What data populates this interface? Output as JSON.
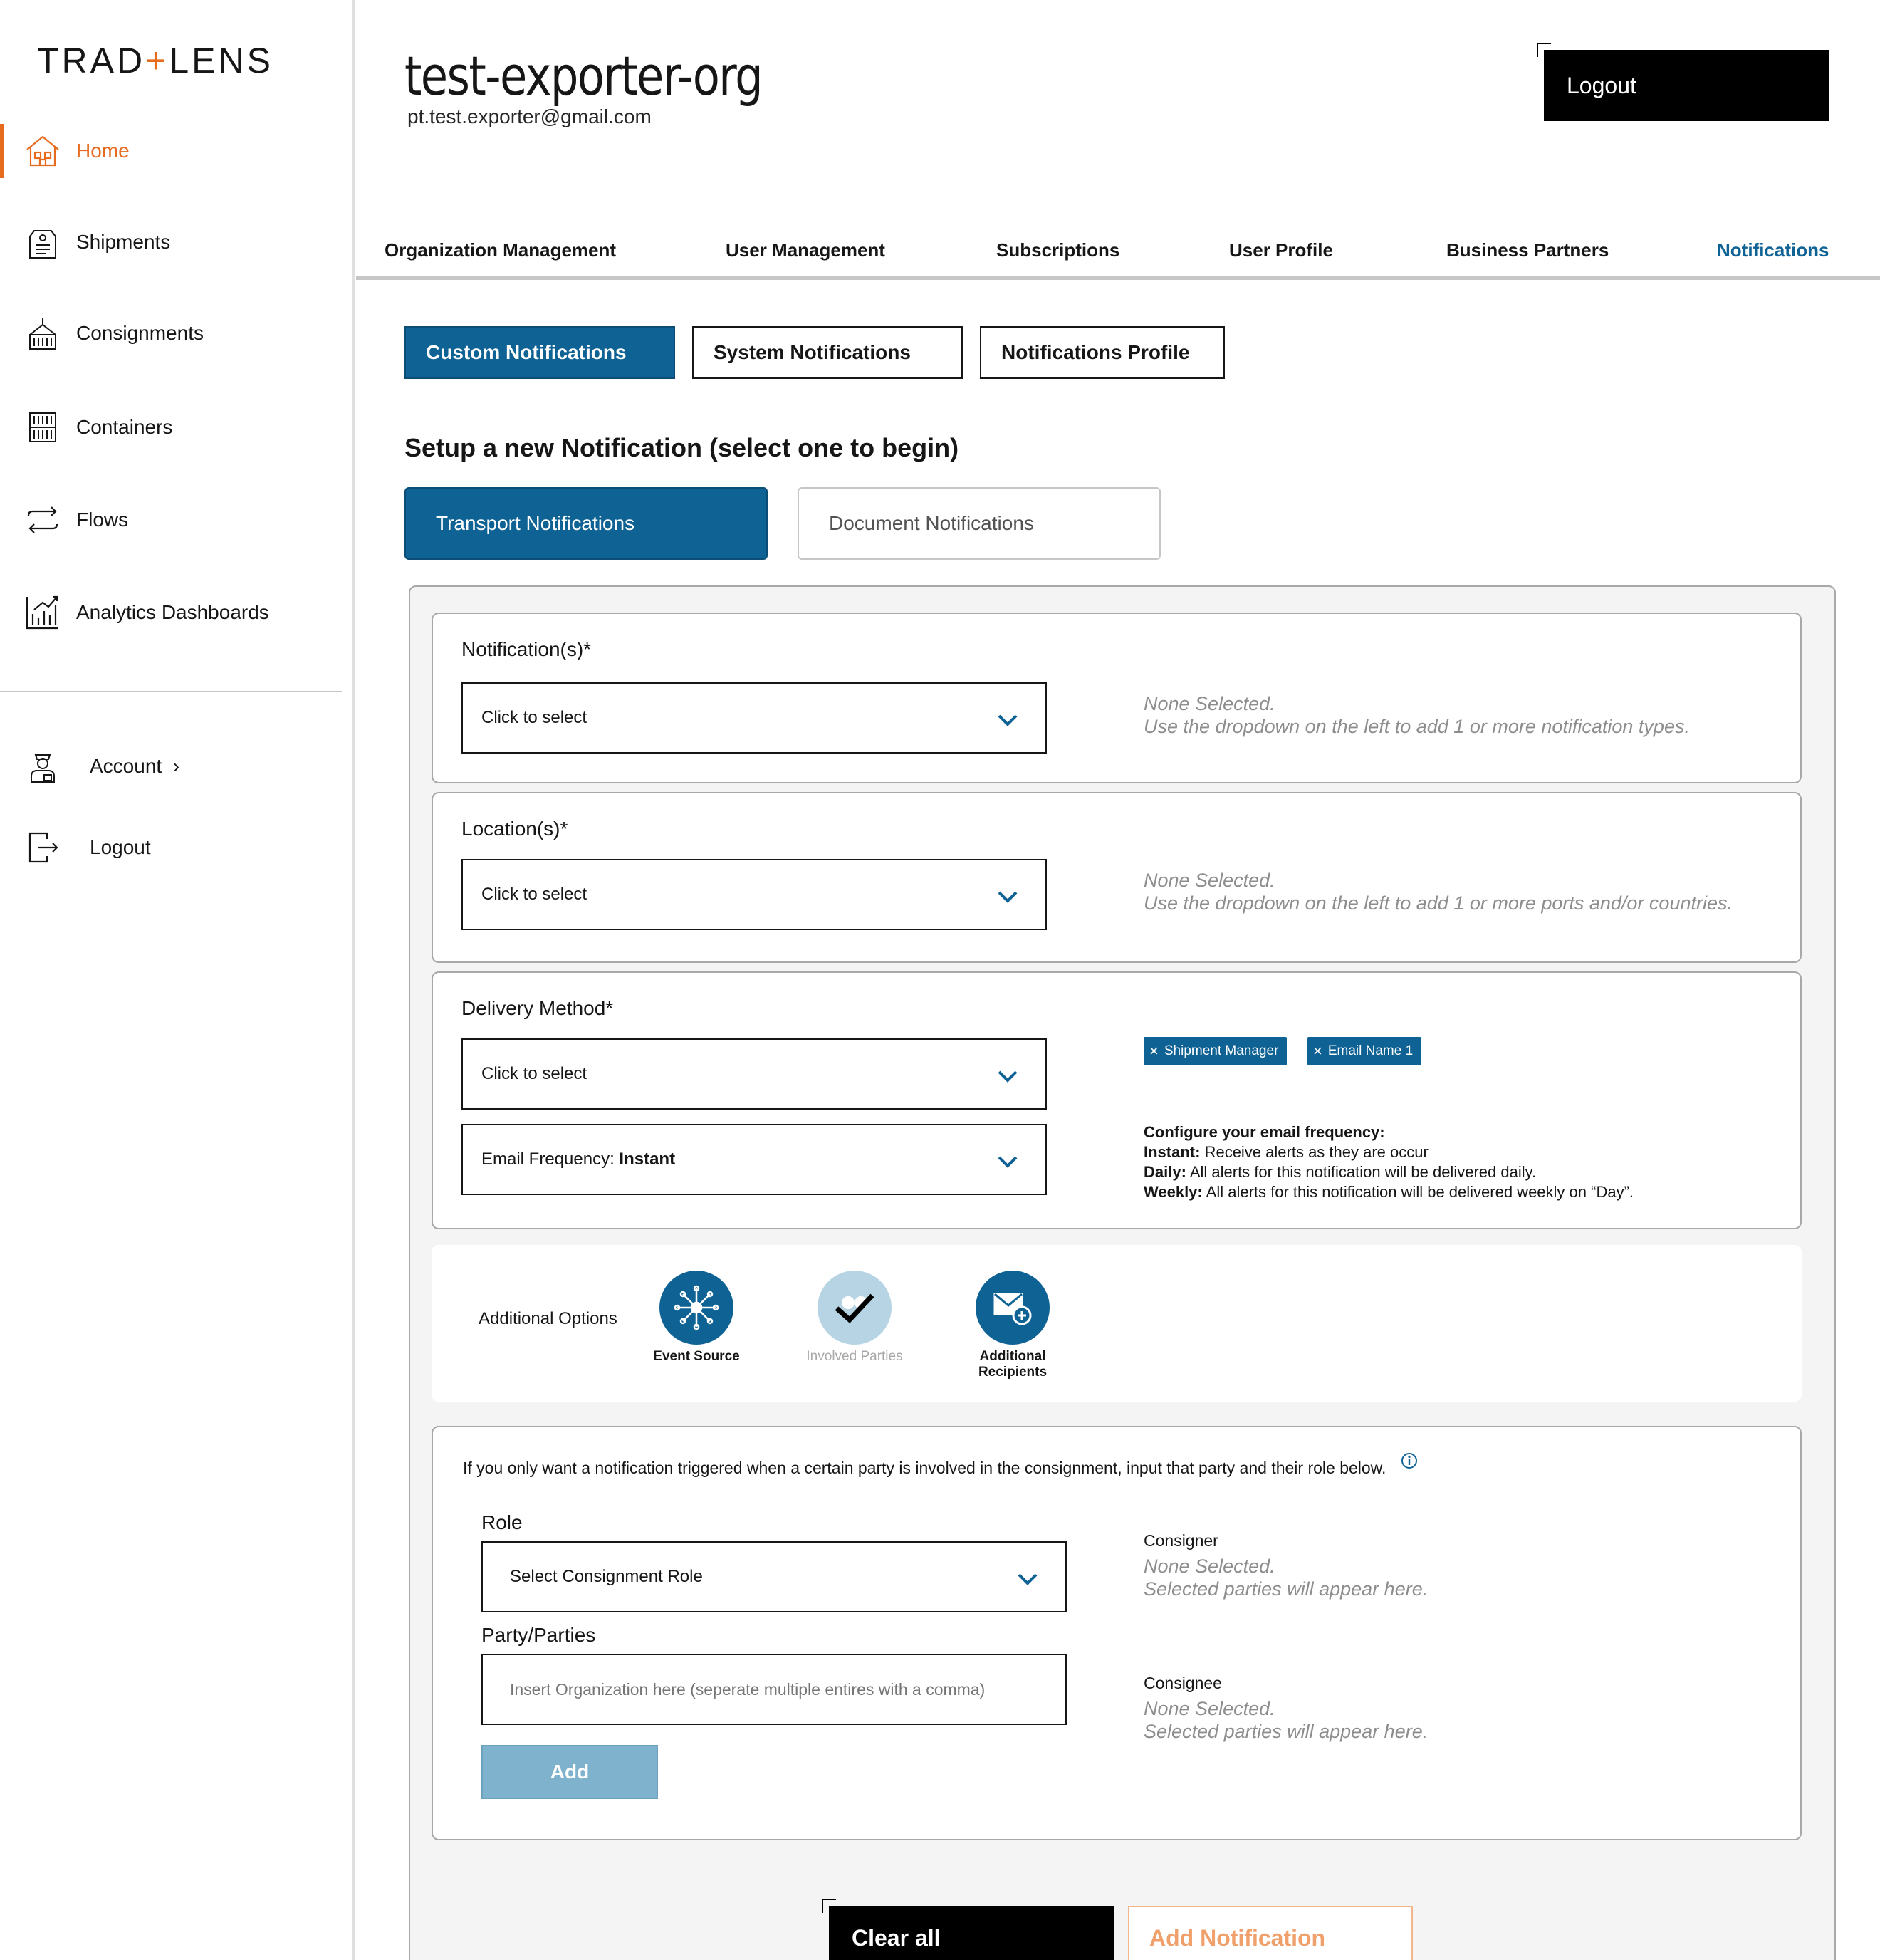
{
  "brand": {
    "logo_left": "TRAD",
    "logo_plus": "+",
    "logo_right": "LENS",
    "accent": "#e66b1f",
    "primary": "#0f6294"
  },
  "sidebar": {
    "items": [
      {
        "label": "Home",
        "icon": "home-icon",
        "active": true
      },
      {
        "label": "Shipments",
        "icon": "shipment-tag-icon"
      },
      {
        "label": "Consignments",
        "icon": "crane-container-icon"
      },
      {
        "label": "Containers",
        "icon": "container-icon"
      },
      {
        "label": "Flows",
        "icon": "flows-arrows-icon"
      },
      {
        "label": "Analytics Dashboards",
        "icon": "analytics-chart-icon"
      }
    ],
    "account_label": "Account",
    "account_chevron": "›",
    "logout_label": "Logout"
  },
  "header": {
    "org_name": "test-exporter-org",
    "email": "pt.test.exporter@gmail.com",
    "logout_label": "Logout"
  },
  "tabs": [
    {
      "label": "Organization Management"
    },
    {
      "label": "User Management"
    },
    {
      "label": "Subscriptions"
    },
    {
      "label": "User Profile"
    },
    {
      "label": "Business Partners"
    },
    {
      "label": "Notifications",
      "active": true
    }
  ],
  "subtabs": [
    {
      "label": "Custom Notifications",
      "active": true
    },
    {
      "label": "System Notifications"
    },
    {
      "label": "Notifications Profile"
    }
  ],
  "setup": {
    "title": "Setup a new Notification (select one to begin)",
    "transport_label": "Transport Notifications",
    "document_label": "Document Notifications"
  },
  "notifications_card": {
    "title": "Notification(s)*",
    "select_label": "Click to select",
    "hint_line1": "None Selected.",
    "hint_line2": "Use the dropdown on the left to add 1 or more notification types."
  },
  "location_card": {
    "title": "Location(s)*",
    "select_label": "Click to select",
    "hint_line1": "None Selected.",
    "hint_line2": "Use the dropdown on the left to add 1 or more ports and/or countries."
  },
  "delivery_card": {
    "title": "Delivery Method*",
    "select_label": "Click to select",
    "frequency_prefix": "Email Frequency: ",
    "frequency_value": "Instant",
    "chips": [
      {
        "label": "Shipment Manager"
      },
      {
        "label": "Email Name 1"
      }
    ],
    "chip_remove": "×",
    "freq_title": "Configure your email frequency:",
    "freq_instant_key": "Instant:",
    "freq_instant_text": " Receive alerts as they are occur",
    "freq_daily_key": "Daily:",
    "freq_daily_text": " All alerts for this notification will be delivered daily.",
    "freq_weekly_key": "Weekly:",
    "freq_weekly_text": " All alerts for this notification will be delivered weekly on “Day”."
  },
  "additional_options": {
    "label": "Additional Options",
    "options": [
      {
        "label": "Event Source",
        "icon": "event-source-network-icon"
      },
      {
        "label": "Involved Parties",
        "icon": "involved-parties-check-icon",
        "disabled": true
      },
      {
        "label_line1": "Additional",
        "label_line2": "Recipients",
        "icon": "add-recipient-mail-icon"
      }
    ]
  },
  "parties_card": {
    "intro": "If you only want a notification triggered when a certain party is involved in the consignment, input that party and their role below.",
    "info_icon": "info-icon",
    "role_label": "Role",
    "role_select": "Select Consignment Role",
    "party_label": "Party/Parties",
    "party_placeholder": "Insert Organization here (seperate multiple entires with a comma)",
    "add_label": "Add",
    "consigner_title": "Consigner",
    "consigner_line1": "None Selected.",
    "consigner_line2": "Selected parties will appear here.",
    "consignee_title": "Consignee",
    "consignee_line1": "None Selected.",
    "consignee_line2": "Selected parties will appear here."
  },
  "footer": {
    "clear_label": "Clear all",
    "add_notification_label": "Add Notification"
  }
}
